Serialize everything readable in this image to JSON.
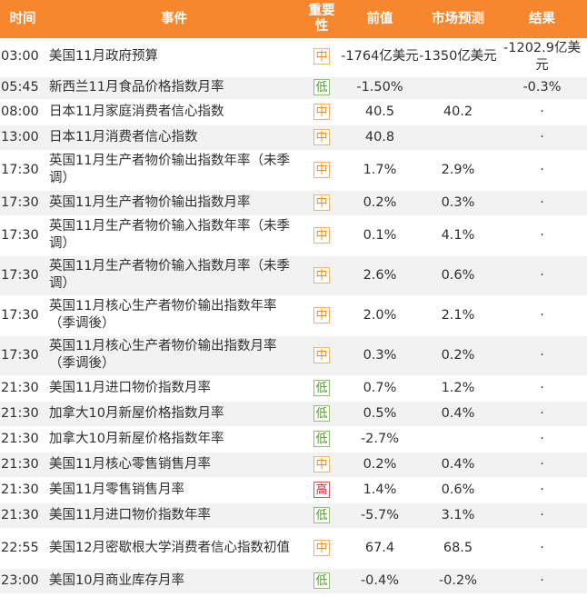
{
  "colors": {
    "header_bg": "#f7862d",
    "header_text": "#ffffff",
    "row_alt_bg": "#f2f2f2",
    "importance_mid": "#f08c1e",
    "importance_low": "#4f9a2b",
    "importance_high": "#d42020"
  },
  "headers": {
    "time": "时间",
    "event": "事件",
    "importance": "重要性",
    "previous": "前值",
    "forecast": "市场预测",
    "result": "结果"
  },
  "rows": [
    {
      "time": "03:00",
      "event": "美国11月政府预算",
      "importance": "中",
      "level": "mid",
      "previous": "-1764亿美元",
      "forecast": "-1350亿美元",
      "result": "-1202.9亿美元"
    },
    {
      "time": "05:45",
      "event": "新西兰11月食品价格指数月率",
      "importance": "低",
      "level": "low",
      "previous": "-1.50%",
      "forecast": "",
      "result": "-0.3%"
    },
    {
      "time": "08:00",
      "event": "日本11月家庭消费者信心指数",
      "importance": "中",
      "level": "mid",
      "previous": "40.5",
      "forecast": "40.2",
      "result": "·"
    },
    {
      "time": "13:00",
      "event": "日本11月消费者信心指数",
      "importance": "中",
      "level": "mid",
      "previous": "40.8",
      "forecast": "",
      "result": "·"
    },
    {
      "time": "17:30",
      "event": "英国11月生产者物价输出指数年率（未季调）",
      "importance": "中",
      "level": "mid",
      "previous": "1.7%",
      "forecast": "2.9%",
      "result": "·"
    },
    {
      "time": "17:30",
      "event": "英国11月生产者物价输出指数月率",
      "importance": "中",
      "level": "mid",
      "previous": "0.2%",
      "forecast": "0.3%",
      "result": "·"
    },
    {
      "time": "17:30",
      "event": "英国11月生产者物价输入指数年率（未季调）",
      "importance": "中",
      "level": "mid",
      "previous": "0.1%",
      "forecast": "4.1%",
      "result": "·"
    },
    {
      "time": "17:30",
      "event": "英国11月生产者物价输入指数月率（未季调）",
      "importance": "中",
      "level": "mid",
      "previous": "2.6%",
      "forecast": "0.6%",
      "result": "·"
    },
    {
      "time": "17:30",
      "event": "英国11月核心生产者物价输出指数年率（季调後）",
      "importance": "中",
      "level": "mid",
      "previous": "2.0%",
      "forecast": "2.1%",
      "result": "·"
    },
    {
      "time": "17:30",
      "event": "英国11月核心生产者物价输出指数月率（季调後）",
      "importance": "中",
      "level": "mid",
      "previous": "0.3%",
      "forecast": "0.2%",
      "result": "·"
    },
    {
      "time": "21:30",
      "event": "美国11月进口物价指数月率",
      "importance": "低",
      "level": "low",
      "previous": "0.7%",
      "forecast": "1.2%",
      "result": "·"
    },
    {
      "time": "21:30",
      "event": "加拿大10月新屋价格指数月率",
      "importance": "低",
      "level": "low",
      "previous": "0.5%",
      "forecast": "0.4%",
      "result": "·"
    },
    {
      "time": "21:30",
      "event": "加拿大10月新屋价格指数年率",
      "importance": "低",
      "level": "low",
      "previous": "-2.7%",
      "forecast": "",
      "result": "·"
    },
    {
      "time": "21:30",
      "event": "美国11月核心零售销售月率",
      "importance": "中",
      "level": "mid",
      "previous": "0.2%",
      "forecast": "0.4%",
      "result": "·"
    },
    {
      "time": "21:30",
      "event": "美国11月零售销售月率",
      "importance": "高",
      "level": "high",
      "previous": "1.4%",
      "forecast": "0.6%",
      "result": "·"
    },
    {
      "time": "21:30",
      "event": "美国11月进口物价指数年率",
      "importance": "低",
      "level": "low",
      "previous": "-5.7%",
      "forecast": "3.1%",
      "result": "·"
    },
    {
      "time": "22:55",
      "event": "美国12月密歇根大学消费者信心指数初值",
      "importance": "中",
      "level": "mid",
      "previous": "67.4",
      "forecast": "68.5",
      "result": "·"
    },
    {
      "time": "23:00",
      "event": "美国10月商业库存月率",
      "importance": "低",
      "level": "low",
      "previous": "-0.4%",
      "forecast": "-0.2%",
      "result": "·"
    }
  ]
}
